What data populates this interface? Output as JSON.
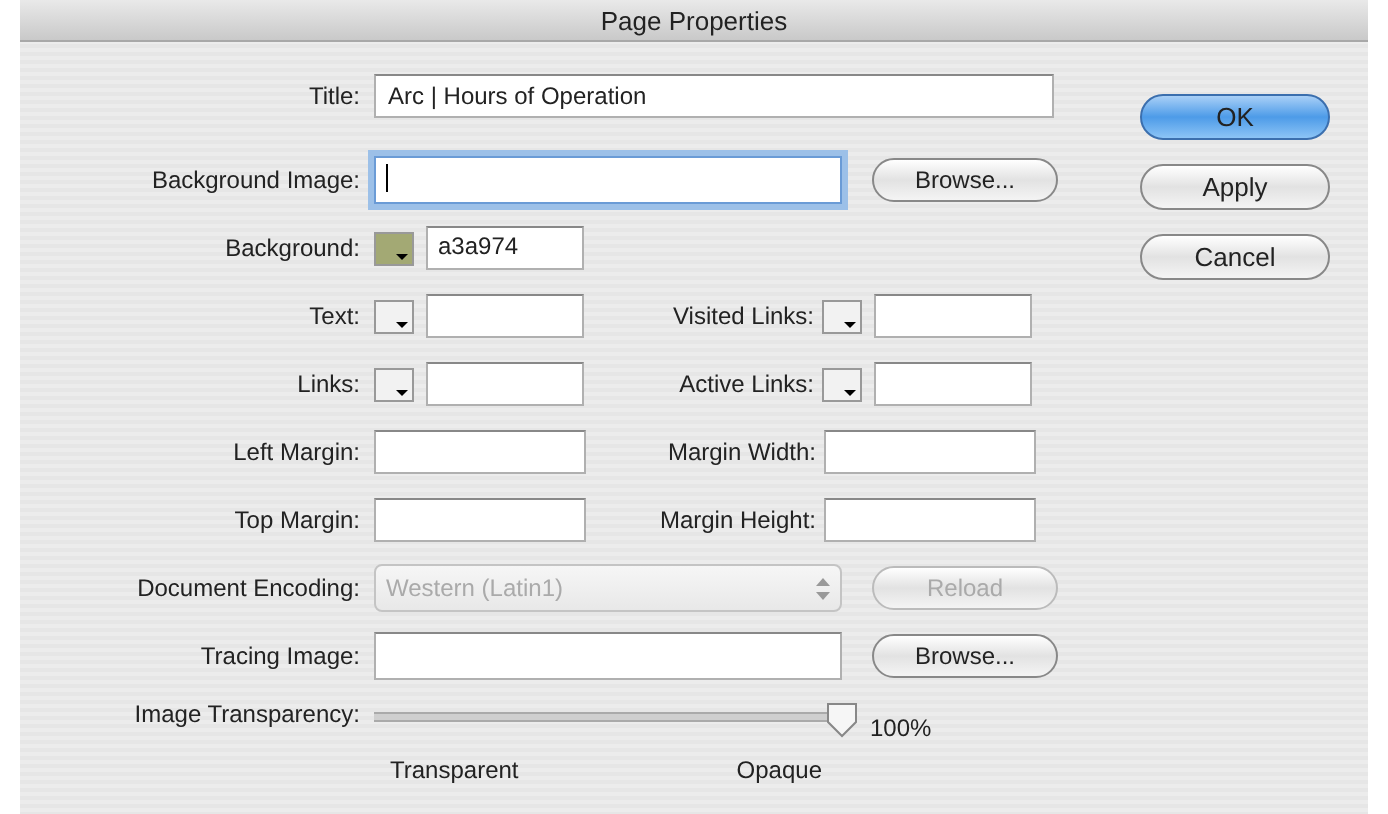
{
  "window": {
    "title": "Page Properties"
  },
  "rows": [
    {
      "kind": "text",
      "fields": [
        {
          "kind": "text",
          "label": "Title:",
          "value": "Arc | Hours of Operation"
        }
      ]
    },
    {
      "kind": "file",
      "fields": [
        {
          "kind": "file",
          "label": "Background Image:",
          "focused": true,
          "button": "Browse..."
        }
      ]
    },
    {
      "kind": "pair",
      "fields": [
        {
          "kind": "color",
          "label": "Background:",
          "color": "#a3a974",
          "value": "a3a974"
        }
      ]
    },
    {
      "kind": "pair",
      "fields": [
        {
          "kind": "color",
          "label": "Text:"
        },
        {
          "kind": "color",
          "label": "Visited Links:"
        }
      ]
    },
    {
      "kind": "pair",
      "fields": [
        {
          "kind": "color",
          "label": "Links:"
        },
        {
          "kind": "color",
          "label": "Active Links:"
        }
      ]
    },
    {
      "kind": "pair",
      "fields": [
        {
          "kind": "number",
          "label": "Left Margin:"
        },
        {
          "kind": "number",
          "label": "Margin Width:"
        }
      ]
    },
    {
      "kind": "pair",
      "fields": [
        {
          "kind": "number",
          "label": "Top Margin:"
        },
        {
          "kind": "number",
          "label": "Margin Height:"
        }
      ]
    },
    {
      "kind": "select",
      "fields": [
        {
          "kind": "select",
          "label": "Document Encoding:",
          "value": "Western (Latin1)",
          "disabled": true,
          "button": "Reload",
          "button_disabled": true
        }
      ]
    },
    {
      "kind": "file",
      "fields": [
        {
          "kind": "file",
          "label": "Tracing Image:",
          "focused": false,
          "button": "Browse..."
        }
      ]
    },
    {
      "kind": "slider",
      "fields": [
        {
          "kind": "slider",
          "label": "Image Transparency:",
          "level": 1,
          "reading": "100%",
          "min_label": "Transparent",
          "max_label": "Opaque"
        }
      ]
    }
  ],
  "buttons": [
    {
      "label": "OK",
      "default": true
    },
    {
      "label": "Apply",
      "default": false
    },
    {
      "label": "Cancel",
      "default": false
    }
  ]
}
